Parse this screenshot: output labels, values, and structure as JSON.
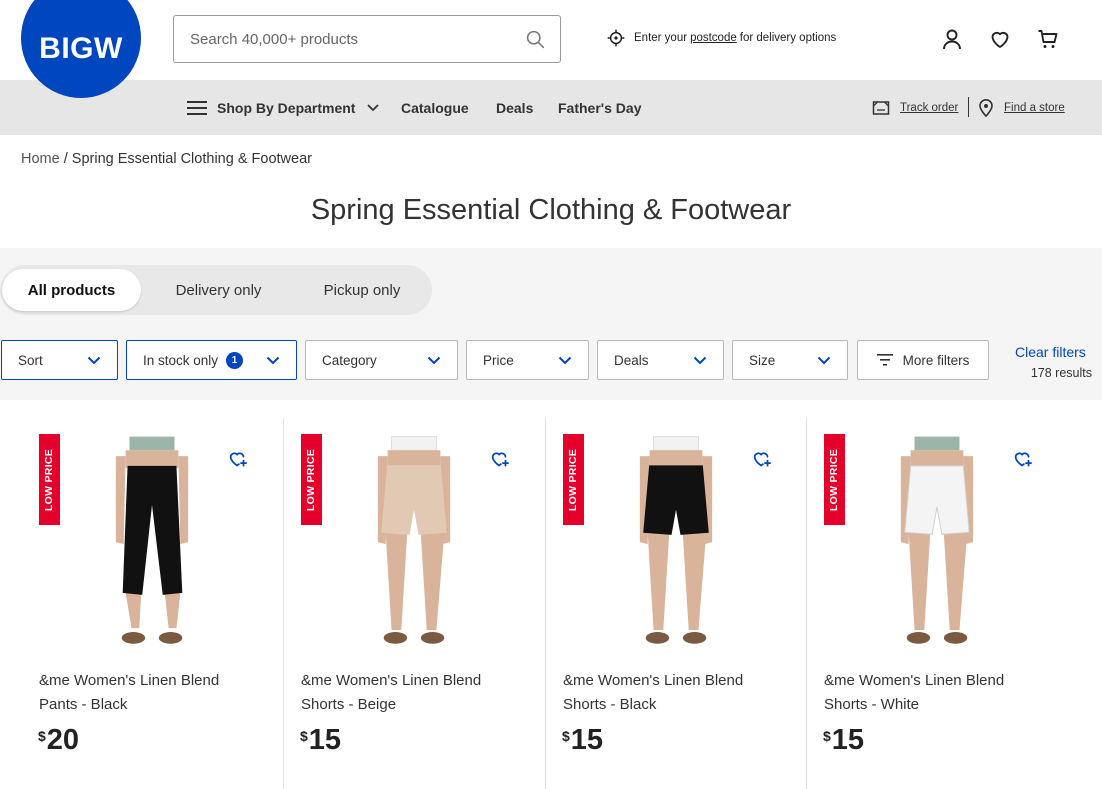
{
  "header": {
    "logo_text": "BIGW",
    "search_placeholder": "Search 40,000+ products",
    "postcode": {
      "prefix": "Enter your",
      "link": "postcode",
      "suffix": "for delivery options"
    }
  },
  "nav": {
    "department": "Shop By Department",
    "items": [
      "Catalogue",
      "Deals",
      "Father's Day"
    ],
    "track_order": "Track order",
    "find_store": "Find a store"
  },
  "breadcrumb": {
    "home": "Home",
    "separator": " / ",
    "current": "Spring Essential Clothing & Footwear"
  },
  "page_title": "Spring Essential Clothing & Footwear",
  "fulfilment_tabs": [
    "All products",
    "Delivery only",
    "Pickup only"
  ],
  "filters": {
    "sort": "Sort",
    "in_stock": "In stock only",
    "in_stock_count": "1",
    "category": "Category",
    "price": "Price",
    "deals": "Deals",
    "size": "Size",
    "more": "More filters",
    "clear": "Clear filters",
    "results": "178 results"
  },
  "products": [
    {
      "ribbon": "LOW PRICE",
      "name_line1": "&me Women's Linen Blend",
      "name_line2": "Pants - Black",
      "currency": "$",
      "price": "20",
      "garment_color": "#111111",
      "variant": "pants"
    },
    {
      "ribbon": "LOW PRICE",
      "name_line1": "&me Women's Linen Blend",
      "name_line2": "Shorts - Beige",
      "currency": "$",
      "price": "15",
      "garment_color": "#e2c9b4",
      "variant": "shorts"
    },
    {
      "ribbon": "LOW PRICE",
      "name_line1": "&me Women's Linen Blend",
      "name_line2": "Shorts - Black",
      "currency": "$",
      "price": "15",
      "garment_color": "#111111",
      "variant": "shorts"
    },
    {
      "ribbon": "LOW PRICE",
      "name_line1": "&me Women's Linen Blend",
      "name_line2": "Shorts - White",
      "currency": "$",
      "price": "15",
      "garment_color": "#f4f4f4",
      "variant": "shorts-white"
    }
  ],
  "colors": {
    "brand_blue": "#0046be",
    "ribbon_red": "#e4002b",
    "nav_bg": "#e6e6e6"
  }
}
